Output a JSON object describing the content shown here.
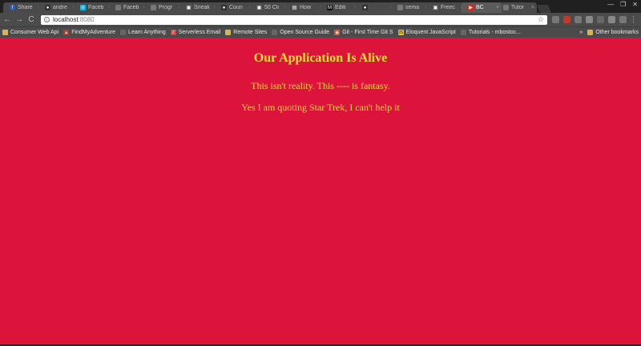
{
  "tabs": [
    {
      "title": "Share",
      "icon": "facebook-icon",
      "color": "#3b5998",
      "glyph": "f"
    },
    {
      "title": "andre",
      "icon": "github-icon",
      "color": "#333333",
      "glyph": "●"
    },
    {
      "title": "Faceb",
      "icon": "vimeo-icon",
      "color": "#1ab7ea",
      "glyph": "v"
    },
    {
      "title": "Faceb",
      "icon": "page-icon",
      "color": "#777777",
      "glyph": ""
    },
    {
      "title": "Progr",
      "icon": "page-icon",
      "color": "#777777",
      "glyph": ""
    },
    {
      "title": "Sneak",
      "icon": "page-icon",
      "color": "#555555",
      "glyph": "▣"
    },
    {
      "title": "Coun",
      "icon": "github-icon",
      "color": "#333333",
      "glyph": "●"
    },
    {
      "title": "50 Cli",
      "icon": "page-icon",
      "color": "#555555",
      "glyph": "▣"
    },
    {
      "title": "How",
      "icon": "page-icon",
      "color": "#555555",
      "glyph": "▤"
    },
    {
      "title": "Editi",
      "icon": "medium-icon",
      "color": "#111111",
      "glyph": "M"
    },
    {
      "title": "",
      "icon": "github-icon",
      "color": "#333333",
      "glyph": "●"
    },
    {
      "title": "sema",
      "icon": "page-icon",
      "color": "#777777",
      "glyph": ""
    },
    {
      "title": "Freec",
      "icon": "page-icon",
      "color": "#555555",
      "glyph": "▣"
    },
    {
      "title": "BC",
      "icon": "youtube-icon",
      "color": "#e62117",
      "glyph": "▶",
      "active": true
    },
    {
      "title": "Tutor",
      "icon": "page-icon",
      "color": "#777777",
      "glyph": ""
    }
  ],
  "window": {
    "minimize": "—",
    "maximize": "❐",
    "close": "✕"
  },
  "toolbar": {
    "back": "←",
    "forward": "→",
    "reload": "C",
    "url_host": "localhost",
    "url_port": ":8080",
    "star": "☆",
    "menu": "⋮"
  },
  "bookmarks": [
    {
      "label": "Consumer Web Api",
      "icon": "folder-icon",
      "color": "#d9b44a",
      "glyph": ""
    },
    {
      "label": "FindMyAdventure",
      "icon": "mountain-icon",
      "color": "#c0392b",
      "glyph": "▲"
    },
    {
      "label": "Learn Anything",
      "icon": "page-icon",
      "color": "#666666",
      "glyph": ""
    },
    {
      "label": "Serverless Email",
      "icon": "z-icon",
      "color": "#d64545",
      "glyph": "Z"
    },
    {
      "label": "Remote Sites",
      "icon": "folder-icon",
      "color": "#d9b44a",
      "glyph": ""
    },
    {
      "label": "Open Source Guide",
      "icon": "page-icon",
      "color": "#666666",
      "glyph": ""
    },
    {
      "label": "Git - First Time Git S",
      "icon": "git-icon",
      "color": "#f05033",
      "glyph": "◆"
    },
    {
      "label": "Eloquent JavaScript",
      "icon": "js-icon",
      "color": "#e8c31c",
      "glyph": "JS"
    },
    {
      "label": "Tutorials - mbostoc...",
      "icon": "page-icon",
      "color": "#666666",
      "glyph": ""
    }
  ],
  "bookmarks_more": "»",
  "other_bookmarks": "Other bookmarks",
  "page": {
    "heading": "Our Application Is Alive",
    "line1": "This isn't reality. This ---- is fantasy.",
    "line2": "Yes I am quoting Star Trek, I can't help it"
  },
  "colors": {
    "page_background": "#dc143c",
    "text": "#f2df3a"
  }
}
